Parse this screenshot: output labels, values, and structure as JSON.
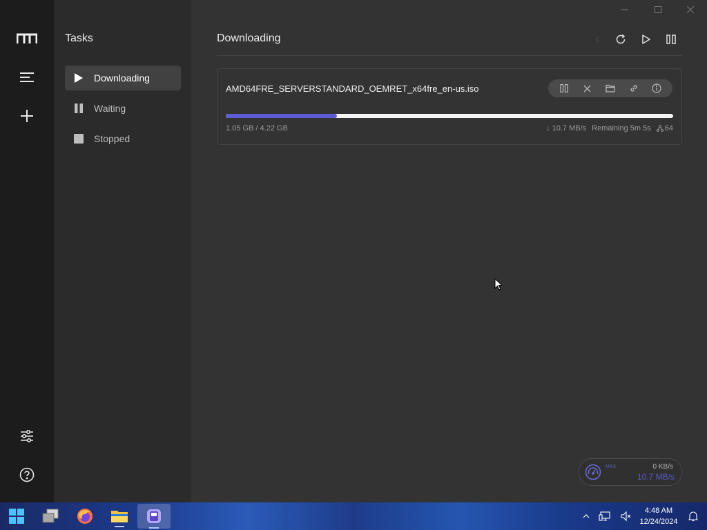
{
  "rail": {
    "icons": [
      "app-logo-icon",
      "menu-icon",
      "add-icon",
      "settings-icon",
      "help-icon"
    ]
  },
  "sidebar": {
    "title": "Tasks",
    "items": [
      {
        "label": "Downloading",
        "icon": "play-icon",
        "active": true
      },
      {
        "label": "Waiting",
        "icon": "pause-icon",
        "active": false
      },
      {
        "label": "Stopped",
        "icon": "stop-icon",
        "active": false
      }
    ]
  },
  "main": {
    "heading": "Downloading"
  },
  "task": {
    "filename": "AMD64FRE_SERVERSTANDARD_OEMRET_x64fre_en-us.iso",
    "sizes": "1.05 GB / 4.22 GB",
    "progress_percent": 24.9,
    "speed": "↓ 10.7 MB/s",
    "remaining": "Remaining 5m 5s",
    "connections": "64"
  },
  "speedometer": {
    "label": "MAX",
    "upload": "0 KB/s",
    "download": "10.7 MB/s"
  },
  "taskbar": {
    "time": "4:48 AM",
    "date": "12/24/2024"
  },
  "colors": {
    "accent": "#5b5bd6",
    "sidebar_bg": "#2b2b2b",
    "rail_bg": "#1c1c1c",
    "main_bg": "#333333"
  }
}
